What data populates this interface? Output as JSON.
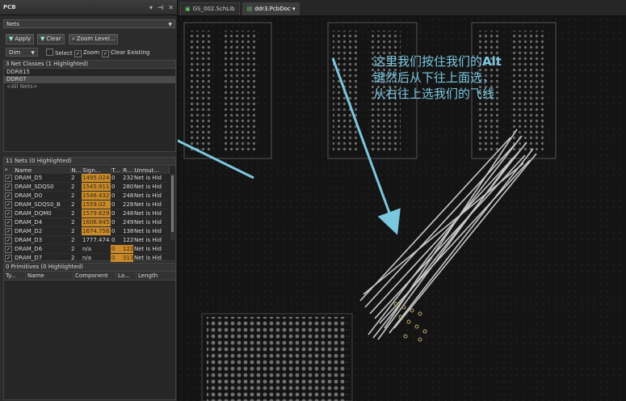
{
  "panel": {
    "title": "PCB",
    "filter_select": "Nets",
    "buttons": {
      "apply": "Apply",
      "clear": "Clear",
      "zoom_level": "Zoom Level..."
    },
    "mode_select": "Dim",
    "checks": {
      "select": "Select",
      "zoom": "Zoom",
      "clear_existing": "Clear Existing"
    },
    "classes": {
      "header": "3 Net Classes (1 Highlighted)",
      "items": [
        "DDR815",
        "DDR07",
        "<All Nets>"
      ]
    },
    "nets": {
      "header": "11 Nets (0 Highlighted)",
      "columns": [
        "*",
        "Name",
        "N...",
        "Sign...",
        "T...",
        "R...",
        "Unrout..."
      ],
      "rows": [
        {
          "name": "DRAM_D5",
          "n": "2",
          "sig": "1495.024",
          "t": "0",
          "r": "232",
          "u": "Net is Hid"
        },
        {
          "name": "DRAM_SDQS0",
          "n": "2",
          "sig": "1545.911",
          "t": "0",
          "r": "280",
          "u": "Net is Hid"
        },
        {
          "name": "DRAM_D0",
          "n": "2",
          "sig": "1546.432",
          "t": "0",
          "r": "248",
          "u": "Net is Hid"
        },
        {
          "name": "DRAM_SDQS0_B",
          "n": "2",
          "sig": "1559.02",
          "t": "0",
          "r": "228",
          "u": "Net is Hid"
        },
        {
          "name": "DRAM_DQM0",
          "n": "2",
          "sig": "1579.629",
          "t": "0",
          "r": "248",
          "u": "Net is Hid"
        },
        {
          "name": "DRAM_D4",
          "n": "2",
          "sig": "1606.845",
          "t": "0",
          "r": "249",
          "u": "Net is Hid"
        },
        {
          "name": "DRAM_D2",
          "n": "2",
          "sig": "1674.756",
          "t": "0",
          "r": "138",
          "u": "Net is Hid"
        },
        {
          "name": "DRAM_D3",
          "n": "2",
          "sig": "1777.474",
          "t": "0",
          "r": "122",
          "u": "Net is Hid"
        },
        {
          "name": "DRAM_D6",
          "n": "2",
          "sig": "n/a",
          "t": "0",
          "r": "122",
          "u": "Net is Hid"
        },
        {
          "name": "DRAM_D7",
          "n": "2",
          "sig": "n/a",
          "t": "0",
          "r": "313",
          "u": "Net is Hid"
        }
      ]
    },
    "primitives": {
      "header": "0 Primitives (0 Highlighted)",
      "columns": [
        "Ty...",
        "Name",
        "Component",
        "La...",
        "Length"
      ]
    }
  },
  "tabs": [
    {
      "label": "GS_002.SchLib",
      "active": false
    },
    {
      "label": "ddr3.PcbDoc",
      "active": true
    }
  ],
  "annotation": {
    "line1_prefix": "这里我们按住我们的",
    "line1_key": "Alt",
    "line2": "键然后从下往上面选，",
    "line3": "从右往上选我们的飞线"
  },
  "colors": {
    "accent_arrow": "#7cc7e0",
    "highlight": "#c98a2a",
    "ratsnest": "#c8c8c8"
  }
}
